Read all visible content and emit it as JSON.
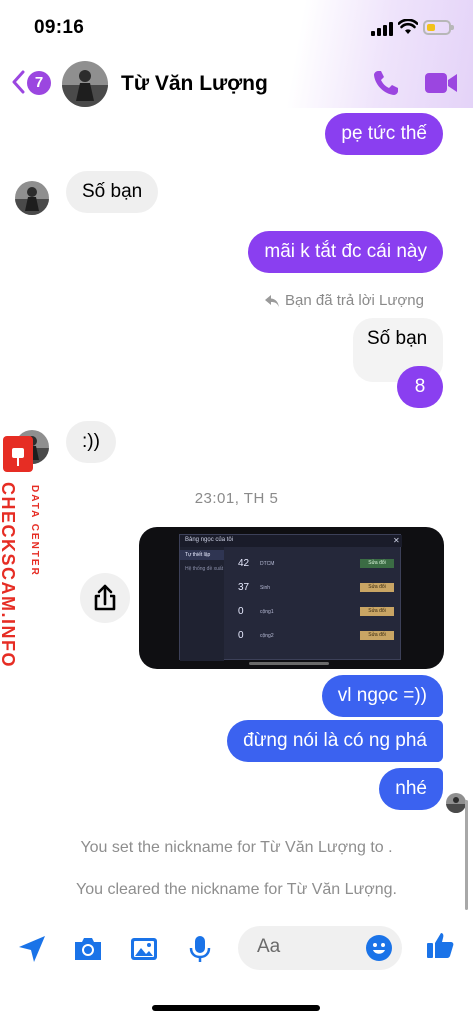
{
  "status_bar": {
    "time": "09:16"
  },
  "header": {
    "back_badge_count": "7",
    "contact_name": "Từ Văn Lượng"
  },
  "messages": [
    {
      "side": "out",
      "color": "purple",
      "text": "pẹ tức thế"
    },
    {
      "side": "in",
      "text": "Số bạn"
    },
    {
      "side": "out",
      "color": "purple",
      "text": "mãi k tắt đc cái này"
    },
    {
      "side": "out",
      "color": "purple",
      "quoted_text": "Số bạn",
      "text": "8"
    },
    {
      "side": "in",
      "text": ":))"
    },
    {
      "side": "out",
      "color": "blue",
      "text": "vl ngọc =))"
    },
    {
      "side": "out",
      "color": "blue",
      "text": "đừng nói là có ng phá"
    },
    {
      "side": "out",
      "color": "blue",
      "text": "nhé"
    }
  ],
  "reply_note": "Bạn đã trả lời Lượng",
  "timestamp": "23:01, TH 5",
  "photo": {
    "title": "Bảng ngọc của tôi",
    "sidebar_items": [
      "Tự thiết lập",
      "Hệ thống đề xuất"
    ],
    "rows": [
      {
        "count": "42",
        "name": "DTCM",
        "action": "Sửa đổi"
      },
      {
        "count": "37",
        "name": "Sinh",
        "action": "Sửa đổi"
      },
      {
        "count": "0",
        "name": "cộng1",
        "action": "Sửa đổi"
      },
      {
        "count": "0",
        "name": "cộng2",
        "action": "Sửa đổi"
      }
    ]
  },
  "system_messages": [
    "You set the nickname for Từ Văn Lượng to .",
    "You cleared the nickname for Từ Văn Lượng."
  ],
  "composer": {
    "placeholder": "Aa"
  },
  "watermark": {
    "title": "CHECKSCAM.INFO",
    "subtitle": "DATA CENTER"
  },
  "colors": {
    "accent_purple": "#8a3ff0",
    "accent_blue": "#3b62f0",
    "icon_blue": "#1a73e8",
    "watermark_red": "#e62d24"
  },
  "icons": [
    "back-chevron-icon",
    "phone-icon",
    "video-camera-icon",
    "share-icon",
    "reply-arrow-icon",
    "send-location-icon",
    "camera-icon",
    "image-icon",
    "microphone-icon",
    "emoji-icon",
    "thumbs-up-icon"
  ]
}
